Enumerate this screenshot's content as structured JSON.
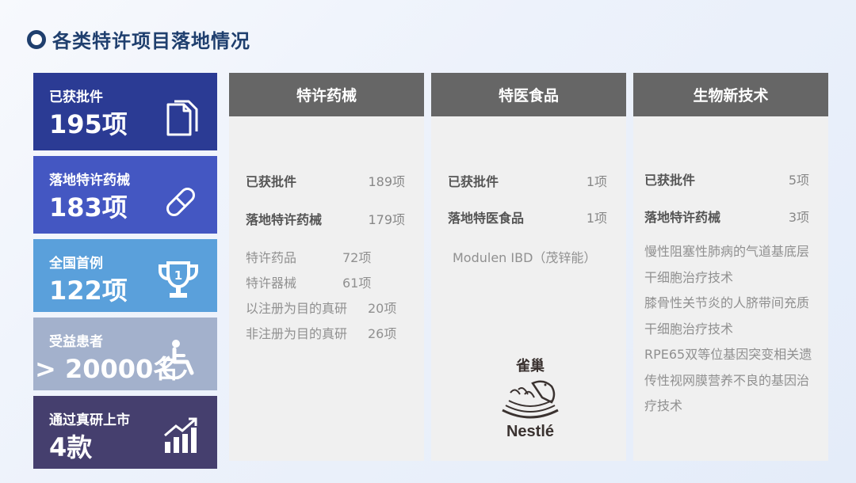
{
  "title": "各类特许项目落地情况",
  "stats": [
    {
      "label": "已获批件",
      "value": "195项",
      "color": "#2b3b94",
      "icon": "document-copy-icon"
    },
    {
      "label": "落地特许药械",
      "value": "183项",
      "color": "#4457c2",
      "icon": "pill-icon"
    },
    {
      "label": "全国首例",
      "value": "122项",
      "color": "#5aa0db",
      "icon": "trophy-icon"
    },
    {
      "label": "受益患者",
      "value": "> 20000名",
      "color": "#a3b1cc",
      "icon": "accessibility-icon"
    },
    {
      "label": "通过真研上市",
      "value": "4款",
      "color": "#453f6e",
      "icon": "growth-chart-icon"
    }
  ],
  "columns": [
    {
      "header": "特许药械",
      "rows": [
        {
          "label": "已获批件",
          "value": "189项"
        },
        {
          "label": "落地特许药械",
          "value": "179项"
        }
      ],
      "subrows": [
        {
          "label": "特许药品",
          "value": "72项"
        },
        {
          "label": "特许器械",
          "value": "61项"
        },
        {
          "label": "以注册为目的真研",
          "value": "20项"
        },
        {
          "label": "非注册为目的真研",
          "value": "26项"
        }
      ]
    },
    {
      "header": "特医食品",
      "rows": [
        {
          "label": "已获批件",
          "value": "1项"
        },
        {
          "label": "落地特医食品",
          "value": "1项"
        }
      ],
      "product": "Modulen IBD（茂锌能）",
      "logo_cn": "雀巢",
      "logo_en": "Nestlé"
    },
    {
      "header": "生物新技术",
      "rows": [
        {
          "label": "已获批件",
          "value": "5项"
        },
        {
          "label": "落地特许药械",
          "value": "3项"
        }
      ],
      "techs": [
        "慢性阻塞性肺病的气道基底层干细胞治疗技术",
        "膝骨性关节炎的人脐带间充质干细胞治疗技术",
        "RPE65双等位基因突变相关遗传性视网膜营养不良的基因治疗技术"
      ]
    }
  ]
}
